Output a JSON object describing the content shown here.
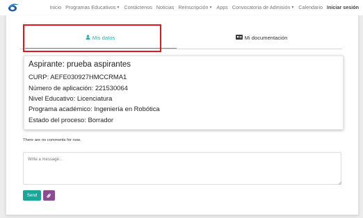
{
  "nav": {
    "items": [
      {
        "label": "Inicio",
        "dropdown": false
      },
      {
        "label": "Programas Educativos",
        "dropdown": true
      },
      {
        "label": "Contáctenos",
        "dropdown": false
      },
      {
        "label": "Noticias",
        "dropdown": false
      },
      {
        "label": "Reinscripción",
        "dropdown": true
      },
      {
        "label": "Apps",
        "dropdown": false
      },
      {
        "label": "Convocatoria de Admisión",
        "dropdown": true
      },
      {
        "label": "Calendario",
        "dropdown": false
      }
    ],
    "login": "Iniciar sesión"
  },
  "tabs": {
    "datos": {
      "label": "Mis datos",
      "icon": "user-icon",
      "active": true
    },
    "docs": {
      "label": "Mi documentación",
      "icon": "id-card-icon",
      "active": false
    }
  },
  "profile": {
    "title": "Aspirante: prueba aspirantes",
    "lines": [
      "CURP: AEFE030927HMCCRMA1",
      "Número de aplicación: 221530064",
      "Nivel Educativo: Licenciatura",
      "Programa académico: Ingeniería en Robótica",
      "Estado del proceso: Borrador"
    ]
  },
  "comments": {
    "empty_note": "There are no comments for now.",
    "placeholder": "Write a message...",
    "send_label": "Send",
    "attach_icon": "paperclip-icon"
  },
  "colors": {
    "accent": "#2ab0a8",
    "send": "#1aa79a",
    "attach": "#8b4d8e",
    "highlight": "#e4141b"
  }
}
